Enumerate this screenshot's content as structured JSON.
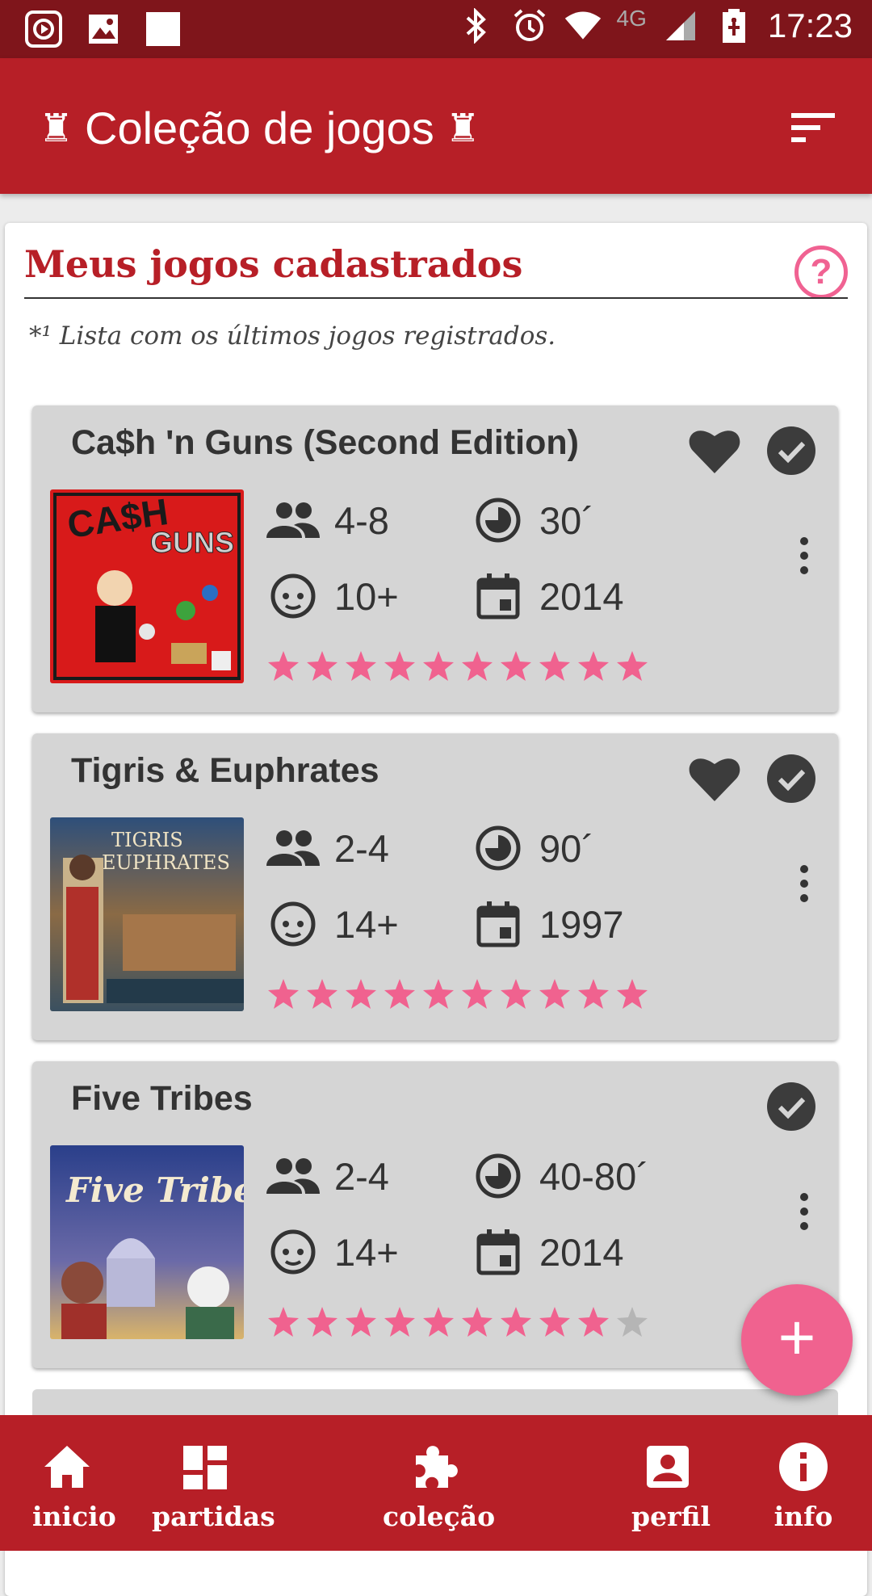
{
  "status_bar": {
    "time": "17:23",
    "network": "4G"
  },
  "app_bar": {
    "title": "Coleção de jogos",
    "sort_icon": "sort-icon"
  },
  "section": {
    "title": "Meus jogos cadastrados",
    "note": "*¹ Lista com os últimos jogos registrados."
  },
  "games": [
    {
      "name": "Ca$h 'n Guns (Second Edition)",
      "players": "4-8",
      "time": "30´",
      "age": "10+",
      "year": "2014",
      "rating": 10,
      "favorite": true,
      "owned": true
    },
    {
      "name": "Tigris & Euphrates",
      "players": "2-4",
      "time": "90´",
      "age": "14+",
      "year": "1997",
      "rating": 10,
      "favorite": true,
      "owned": true
    },
    {
      "name": "Five Tribes",
      "players": "2-4",
      "time": "40-80´",
      "age": "14+",
      "year": "2014",
      "rating": 9,
      "favorite": false,
      "owned": true
    }
  ],
  "rating_max": 10,
  "colors": {
    "primary": "#b71f27",
    "status_bar": "#7f151b",
    "accent": "#f0628f",
    "card": "#d5d5d5"
  },
  "bottom_nav": [
    {
      "label": "inicio",
      "icon": "home-icon"
    },
    {
      "label": "partidas",
      "icon": "dashboard-icon"
    },
    {
      "label": "coleção",
      "icon": "puzzle-icon"
    },
    {
      "label": "perfil",
      "icon": "account-box-icon"
    },
    {
      "label": "info",
      "icon": "info-icon"
    }
  ]
}
